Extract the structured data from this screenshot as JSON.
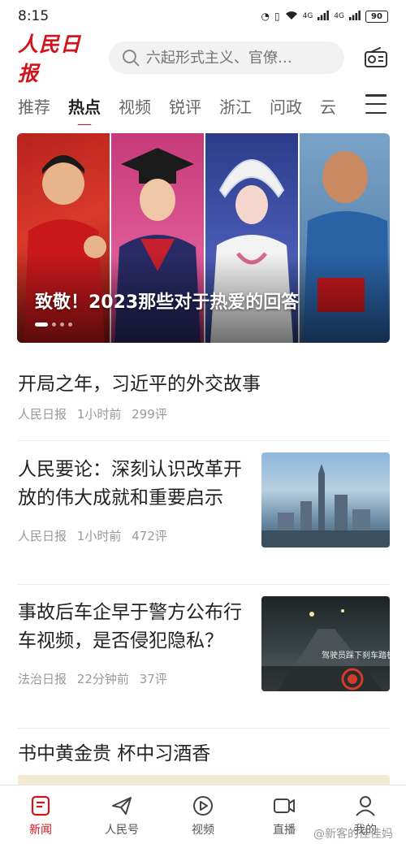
{
  "status_bar": {
    "time": "8:15",
    "network1": "4G",
    "network2": "4G",
    "battery": "90"
  },
  "header": {
    "logo": "人民日报",
    "search_placeholder": "六起形式主义、官僚…"
  },
  "tabs": [
    {
      "label": "推荐"
    },
    {
      "label": "热点"
    },
    {
      "label": "视频"
    },
    {
      "label": "锐评"
    },
    {
      "label": "浙江"
    },
    {
      "label": "问政"
    },
    {
      "label": "云"
    }
  ],
  "active_tab": "热点",
  "banner": {
    "title": "致敬！2023那些对于热爱的回答",
    "slide_count": 4,
    "active_slide": 1
  },
  "news": [
    {
      "title": "开局之年，习近平的外交故事",
      "source": "人民日报",
      "time": "1小时前",
      "comments": "299评"
    },
    {
      "title": "人民要论：深刻认识改革开放的伟大成就和重要启示",
      "source": "人民日报",
      "time": "1小时前",
      "comments": "472评",
      "thumb_caption": ""
    },
    {
      "title": "事故后车企早于警方公布行车视频，是否侵犯隐私？",
      "source": "法治日报",
      "time": "22分钟前",
      "comments": "37评",
      "thumb_caption": "驾驶员踩下刹车踏板"
    },
    {
      "title": "书中黄金贵 杯中习酒香"
    }
  ],
  "bottom_nav": [
    {
      "label": "新闻",
      "icon": "news-icon"
    },
    {
      "label": "人民号",
      "icon": "paper-plane-icon"
    },
    {
      "label": "视频",
      "icon": "play-icon"
    },
    {
      "label": "直播",
      "icon": "camera-icon"
    },
    {
      "label": "我的",
      "icon": "user-icon"
    }
  ],
  "watermark": "@新客的佳佳妈",
  "colors": {
    "brand": "#d2141c",
    "text": "#222222",
    "meta": "#999999"
  }
}
